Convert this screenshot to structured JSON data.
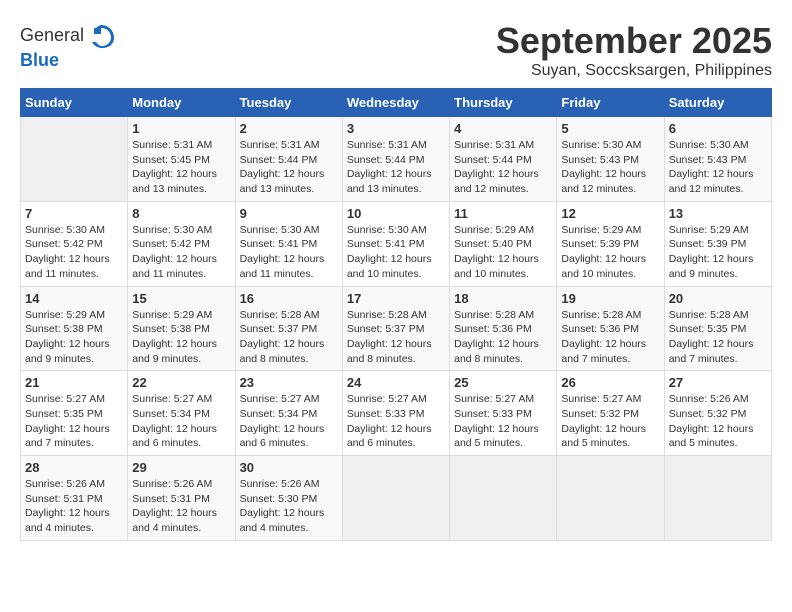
{
  "header": {
    "logo_general": "General",
    "logo_blue": "Blue",
    "title": "September 2025",
    "subtitle": "Suyan, Soccsksargen, Philippines"
  },
  "days_of_week": [
    "Sunday",
    "Monday",
    "Tuesday",
    "Wednesday",
    "Thursday",
    "Friday",
    "Saturday"
  ],
  "weeks": [
    [
      {
        "day": "",
        "info": ""
      },
      {
        "day": "1",
        "info": "Sunrise: 5:31 AM\nSunset: 5:45 PM\nDaylight: 12 hours\nand 13 minutes."
      },
      {
        "day": "2",
        "info": "Sunrise: 5:31 AM\nSunset: 5:44 PM\nDaylight: 12 hours\nand 13 minutes."
      },
      {
        "day": "3",
        "info": "Sunrise: 5:31 AM\nSunset: 5:44 PM\nDaylight: 12 hours\nand 13 minutes."
      },
      {
        "day": "4",
        "info": "Sunrise: 5:31 AM\nSunset: 5:44 PM\nDaylight: 12 hours\nand 12 minutes."
      },
      {
        "day": "5",
        "info": "Sunrise: 5:30 AM\nSunset: 5:43 PM\nDaylight: 12 hours\nand 12 minutes."
      },
      {
        "day": "6",
        "info": "Sunrise: 5:30 AM\nSunset: 5:43 PM\nDaylight: 12 hours\nand 12 minutes."
      }
    ],
    [
      {
        "day": "7",
        "info": "Sunrise: 5:30 AM\nSunset: 5:42 PM\nDaylight: 12 hours\nand 11 minutes."
      },
      {
        "day": "8",
        "info": "Sunrise: 5:30 AM\nSunset: 5:42 PM\nDaylight: 12 hours\nand 11 minutes."
      },
      {
        "day": "9",
        "info": "Sunrise: 5:30 AM\nSunset: 5:41 PM\nDaylight: 12 hours\nand 11 minutes."
      },
      {
        "day": "10",
        "info": "Sunrise: 5:30 AM\nSunset: 5:41 PM\nDaylight: 12 hours\nand 10 minutes."
      },
      {
        "day": "11",
        "info": "Sunrise: 5:29 AM\nSunset: 5:40 PM\nDaylight: 12 hours\nand 10 minutes."
      },
      {
        "day": "12",
        "info": "Sunrise: 5:29 AM\nSunset: 5:39 PM\nDaylight: 12 hours\nand 10 minutes."
      },
      {
        "day": "13",
        "info": "Sunrise: 5:29 AM\nSunset: 5:39 PM\nDaylight: 12 hours\nand 9 minutes."
      }
    ],
    [
      {
        "day": "14",
        "info": "Sunrise: 5:29 AM\nSunset: 5:38 PM\nDaylight: 12 hours\nand 9 minutes."
      },
      {
        "day": "15",
        "info": "Sunrise: 5:29 AM\nSunset: 5:38 PM\nDaylight: 12 hours\nand 9 minutes."
      },
      {
        "day": "16",
        "info": "Sunrise: 5:28 AM\nSunset: 5:37 PM\nDaylight: 12 hours\nand 8 minutes."
      },
      {
        "day": "17",
        "info": "Sunrise: 5:28 AM\nSunset: 5:37 PM\nDaylight: 12 hours\nand 8 minutes."
      },
      {
        "day": "18",
        "info": "Sunrise: 5:28 AM\nSunset: 5:36 PM\nDaylight: 12 hours\nand 8 minutes."
      },
      {
        "day": "19",
        "info": "Sunrise: 5:28 AM\nSunset: 5:36 PM\nDaylight: 12 hours\nand 7 minutes."
      },
      {
        "day": "20",
        "info": "Sunrise: 5:28 AM\nSunset: 5:35 PM\nDaylight: 12 hours\nand 7 minutes."
      }
    ],
    [
      {
        "day": "21",
        "info": "Sunrise: 5:27 AM\nSunset: 5:35 PM\nDaylight: 12 hours\nand 7 minutes."
      },
      {
        "day": "22",
        "info": "Sunrise: 5:27 AM\nSunset: 5:34 PM\nDaylight: 12 hours\nand 6 minutes."
      },
      {
        "day": "23",
        "info": "Sunrise: 5:27 AM\nSunset: 5:34 PM\nDaylight: 12 hours\nand 6 minutes."
      },
      {
        "day": "24",
        "info": "Sunrise: 5:27 AM\nSunset: 5:33 PM\nDaylight: 12 hours\nand 6 minutes."
      },
      {
        "day": "25",
        "info": "Sunrise: 5:27 AM\nSunset: 5:33 PM\nDaylight: 12 hours\nand 5 minutes."
      },
      {
        "day": "26",
        "info": "Sunrise: 5:27 AM\nSunset: 5:32 PM\nDaylight: 12 hours\nand 5 minutes."
      },
      {
        "day": "27",
        "info": "Sunrise: 5:26 AM\nSunset: 5:32 PM\nDaylight: 12 hours\nand 5 minutes."
      }
    ],
    [
      {
        "day": "28",
        "info": "Sunrise: 5:26 AM\nSunset: 5:31 PM\nDaylight: 12 hours\nand 4 minutes."
      },
      {
        "day": "29",
        "info": "Sunrise: 5:26 AM\nSunset: 5:31 PM\nDaylight: 12 hours\nand 4 minutes."
      },
      {
        "day": "30",
        "info": "Sunrise: 5:26 AM\nSunset: 5:30 PM\nDaylight: 12 hours\nand 4 minutes."
      },
      {
        "day": "",
        "info": ""
      },
      {
        "day": "",
        "info": ""
      },
      {
        "day": "",
        "info": ""
      },
      {
        "day": "",
        "info": ""
      }
    ]
  ]
}
